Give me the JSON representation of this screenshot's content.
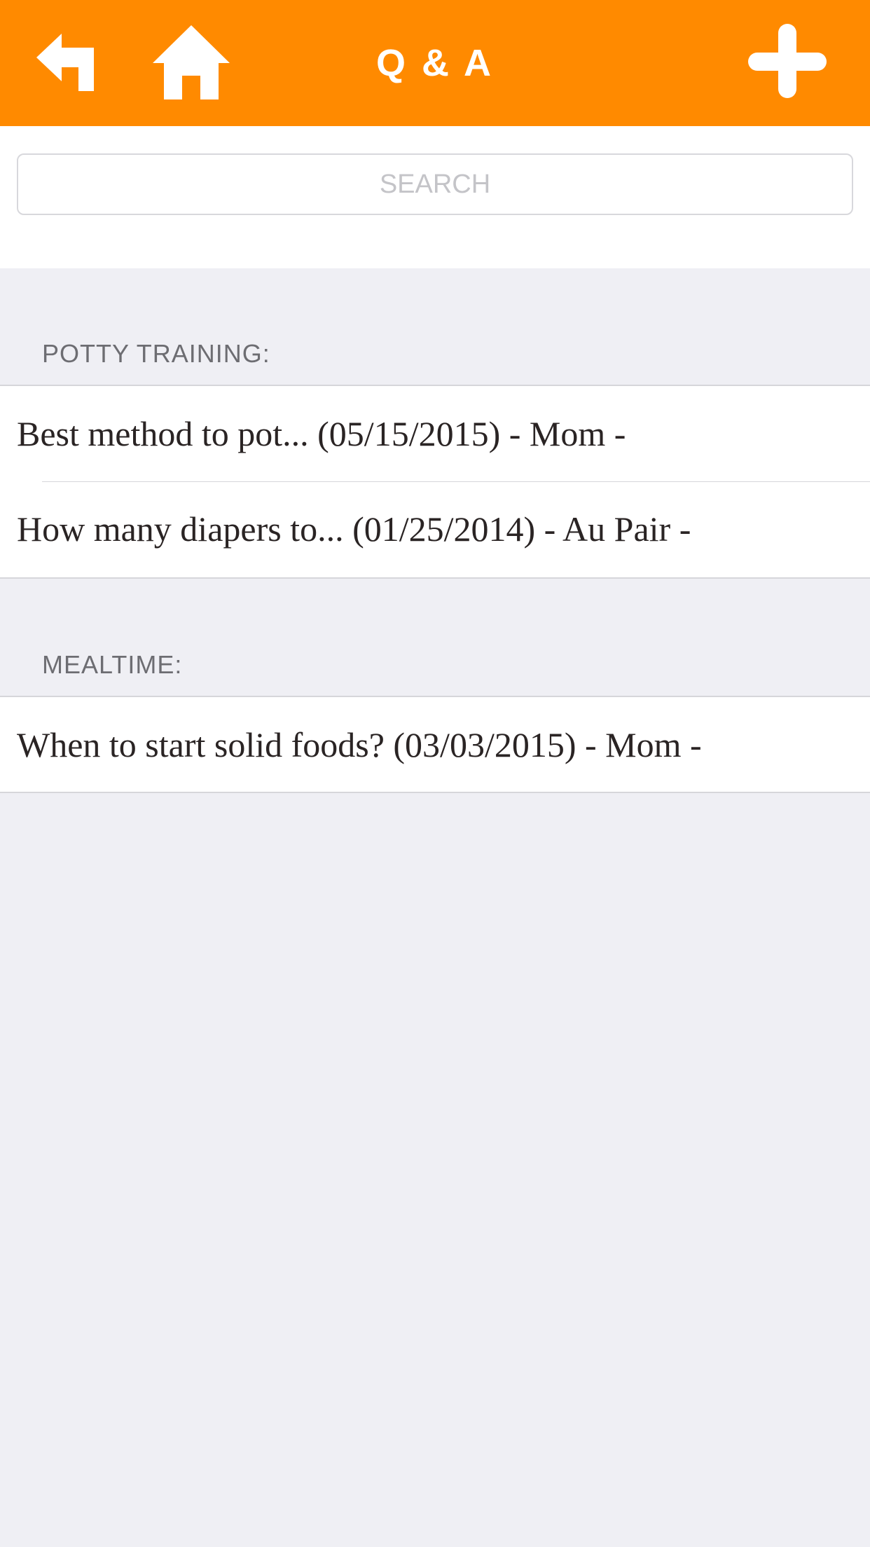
{
  "nav": {
    "title": "Q & A",
    "back_icon": "back-arrow-icon",
    "home_icon": "home-icon",
    "add_icon": "plus-icon",
    "bar_color": "#ff8a00"
  },
  "search": {
    "placeholder": "SEARCH",
    "value": ""
  },
  "sections": [
    {
      "header": "POTTY TRAINING:",
      "items": [
        {
          "label": "Best method to pot... (05/15/2015) - Mom -"
        },
        {
          "label": "How many diapers to... (01/25/2014) - Au Pair -"
        }
      ]
    },
    {
      "header": "MEALTIME:",
      "items": [
        {
          "label": "When to start solid foods? (03/03/2015) - Mom -"
        }
      ]
    }
  ]
}
